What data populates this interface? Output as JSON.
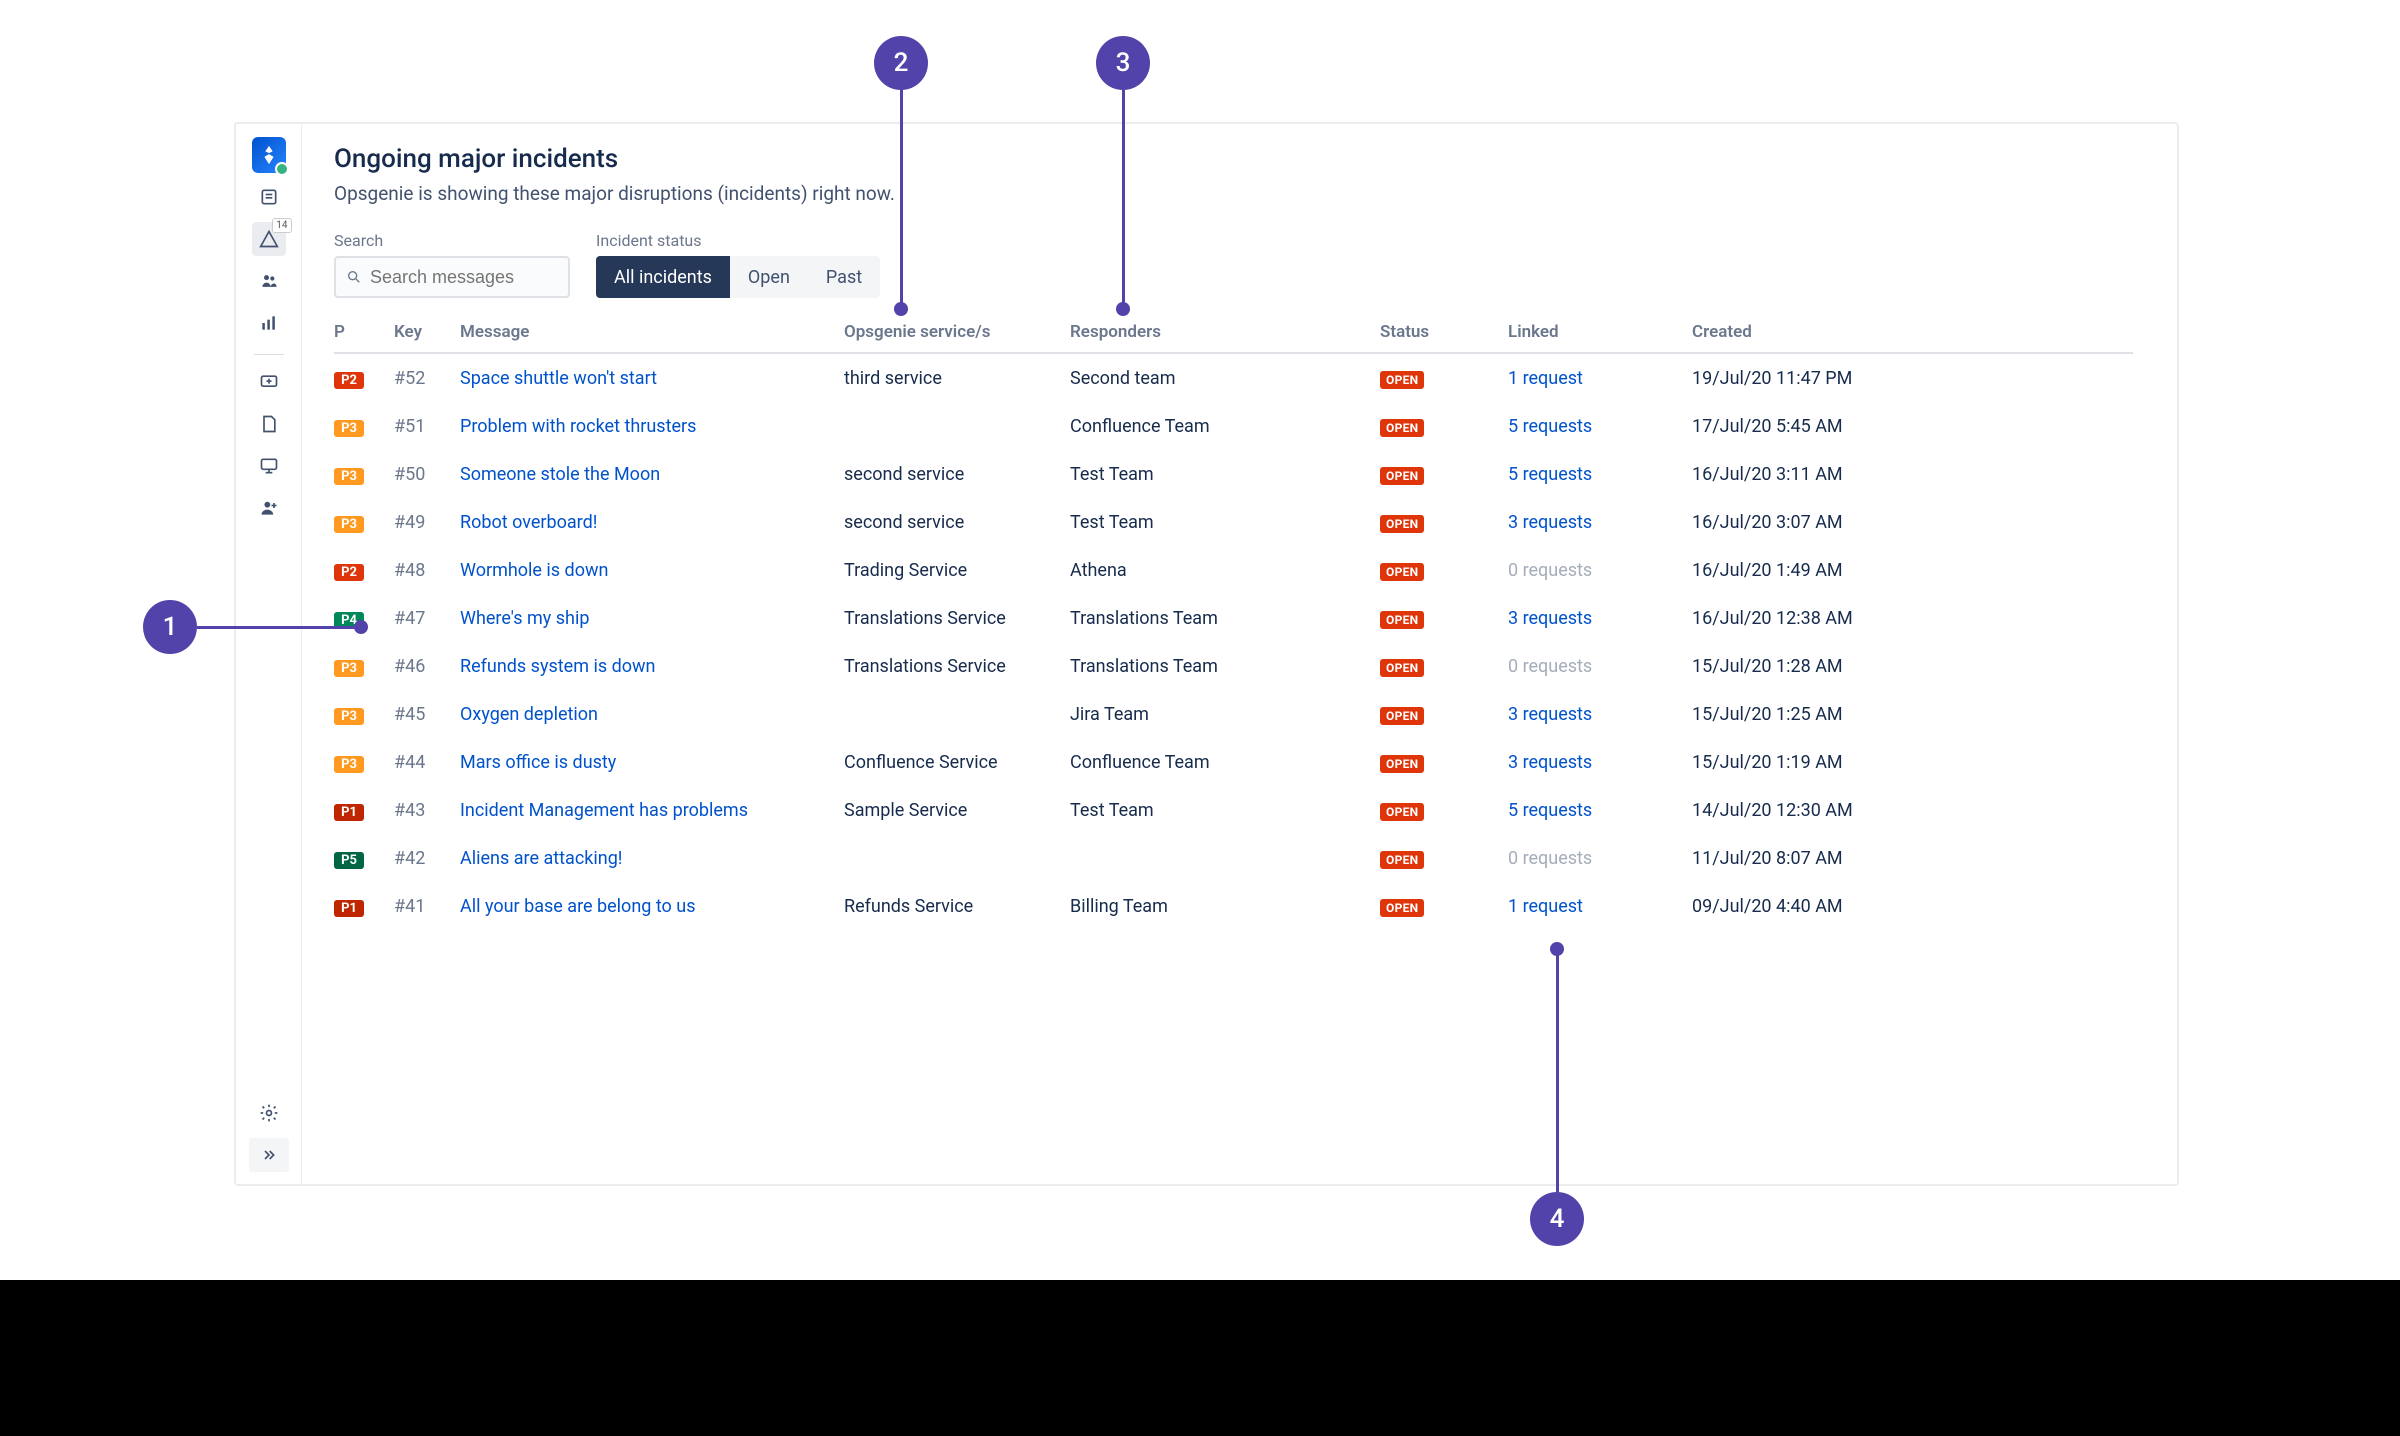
{
  "page": {
    "title": "Ongoing major incidents",
    "subtitle": "Opsgenie is showing these major disruptions (incidents) right now."
  },
  "nav": {
    "alerts_badge": "14"
  },
  "filters": {
    "search_label": "Search",
    "search_placeholder": "Search messages",
    "status_label": "Incident status",
    "segments": {
      "all": "All incidents",
      "open": "Open",
      "past": "Past"
    }
  },
  "columns": {
    "p": "P",
    "key": "Key",
    "message": "Message",
    "service": "Opsgenie service/s",
    "responders": "Responders",
    "status": "Status",
    "linked": "Linked",
    "created": "Created"
  },
  "statuses": {
    "open": "OPEN"
  },
  "rows": [
    {
      "p": "P2",
      "key": "#52",
      "message": "Space shuttle won't start",
      "service": "third service",
      "responders": "Second team",
      "linked": "1 request",
      "linked_zero": false,
      "created": "19/Jul/20 11:47 PM"
    },
    {
      "p": "P3",
      "key": "#51",
      "message": "Problem with rocket thrusters",
      "service": "",
      "responders": "Confluence Team",
      "linked": "5 requests",
      "linked_zero": false,
      "created": "17/Jul/20 5:45 AM"
    },
    {
      "p": "P3",
      "key": "#50",
      "message": "Someone stole the Moon",
      "service": "second service",
      "responders": "Test Team",
      "linked": "5 requests",
      "linked_zero": false,
      "created": "16/Jul/20 3:11 AM"
    },
    {
      "p": "P3",
      "key": "#49",
      "message": "Robot overboard!",
      "service": "second service",
      "responders": "Test Team",
      "linked": "3 requests",
      "linked_zero": false,
      "created": "16/Jul/20 3:07 AM"
    },
    {
      "p": "P2",
      "key": "#48",
      "message": "Wormhole is down",
      "service": "Trading Service",
      "responders": "Athena",
      "linked": "0 requests",
      "linked_zero": true,
      "created": "16/Jul/20 1:49 AM"
    },
    {
      "p": "P4",
      "key": "#47",
      "message": "Where's my ship",
      "service": "Translations Service",
      "responders": "Translations Team",
      "linked": "3 requests",
      "linked_zero": false,
      "created": "16/Jul/20 12:38 AM"
    },
    {
      "p": "P3",
      "key": "#46",
      "message": "Refunds system is down",
      "service": "Translations Service",
      "responders": "Translations Team",
      "linked": "0 requests",
      "linked_zero": true,
      "created": "15/Jul/20 1:28 AM"
    },
    {
      "p": "P3",
      "key": "#45",
      "message": "Oxygen depletion",
      "service": "",
      "responders": "Jira Team",
      "linked": "3 requests",
      "linked_zero": false,
      "created": "15/Jul/20 1:25 AM"
    },
    {
      "p": "P3",
      "key": "#44",
      "message": "Mars office is dusty",
      "service": "Confluence Service",
      "responders": "Confluence Team",
      "linked": "3 requests",
      "linked_zero": false,
      "created": "15/Jul/20 1:19 AM"
    },
    {
      "p": "P1",
      "key": "#43",
      "message": "Incident Management has problems",
      "service": "Sample Service",
      "responders": "Test Team",
      "linked": "5 requests",
      "linked_zero": false,
      "created": "14/Jul/20 12:30 AM"
    },
    {
      "p": "P5",
      "key": "#42",
      "message": "Aliens are attacking!",
      "service": "",
      "responders": "",
      "linked": "0 requests",
      "linked_zero": true,
      "created": "11/Jul/20 8:07 AM"
    },
    {
      "p": "P1",
      "key": "#41",
      "message": "All your base are belong to us",
      "service": "Refunds Service",
      "responders": "Billing Team",
      "linked": "1 request",
      "linked_zero": false,
      "created": "09/Jul/20 4:40 AM"
    }
  ],
  "annotations": {
    "n1": "1",
    "n2": "2",
    "n3": "3",
    "n4": "4"
  }
}
